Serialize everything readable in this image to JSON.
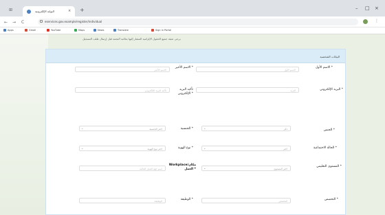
{
  "browser": {
    "tab_title": "البوابة الإلكترونية",
    "tab_close": "×",
    "new_tab": "+",
    "url": "eservices.gov.example/register/individual",
    "window_controls": {
      "minimize": "–",
      "maximize": "□",
      "close": "×"
    },
    "nav": {
      "back": "←",
      "forward": "→",
      "reload": "C"
    },
    "bookmarks": [
      {
        "label": "Apps",
        "color": "#4a7fc1"
      },
      {
        "label": "Gmail",
        "color": "#d34836"
      },
      {
        "label": "YouTube",
        "color": "#e52d27"
      },
      {
        "label": "Maps",
        "color": "#3aa757"
      },
      {
        "label": "News",
        "color": "#4a7fc1"
      },
      {
        "label": "Translate",
        "color": "#4a7fc1"
      },
      {
        "label": "Sign in Portal",
        "color": "#d34836"
      }
    ]
  },
  "notice": "يرجى تعبئة جميع الحقول الإلزامية المشار إليها بعلامة النجمة قبل إرسال طلب التسجيل",
  "form": {
    "header_title": "البيانات الشخصية",
    "fields": {
      "first_name": {
        "label": "الاسم الأول *",
        "placeholder": "الاسم الأول"
      },
      "last_name": {
        "label": "الاسم الأخير *",
        "placeholder": "الاسم الأخير"
      },
      "email": {
        "label": "البريد الإلكتروني *",
        "placeholder": "البريد"
      },
      "confirm_email": {
        "label": "تأكيد البريد الإلكتروني *",
        "placeholder": "تأكيد البريد الإلكتروني"
      },
      "gender": {
        "label": "الجنس *",
        "value": "ذكر"
      },
      "nationality": {
        "label": "الجنسية *",
        "value": "اختر الجنسية"
      },
      "marital_status": {
        "label": "الحالة الاجتماعية *",
        "value": "اختر"
      },
      "id_type": {
        "label": "نوع الهوية *",
        "value": "اختر نوع الهوية"
      },
      "education": {
        "label": "المستوى التعليمي *",
        "value": "اختر المستوى"
      },
      "workplace": {
        "label": "Workplace/مكان العمل *",
        "placeholder": "اسم جهة العمل الحالية"
      },
      "qualification": {
        "label": "التخصص *",
        "placeholder": "التخصص"
      },
      "job": {
        "label": "الوظيفة *",
        "placeholder": "الوظيفة"
      }
    }
  }
}
